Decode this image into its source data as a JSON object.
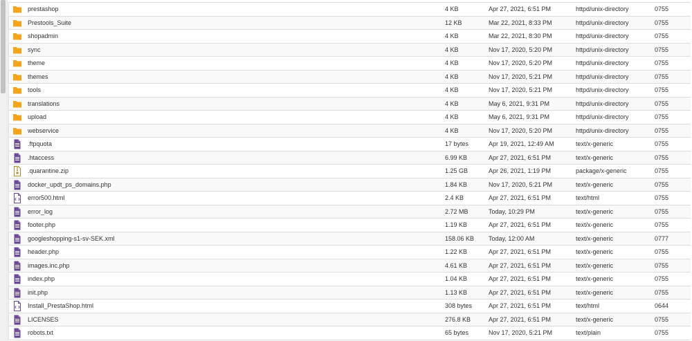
{
  "colors": {
    "folder": "#f3a51c",
    "file": "#6c4a95",
    "archive": "#b08a2e",
    "border": "#dcdcdc"
  },
  "files": [
    {
      "name": "prestashop",
      "size": "4 KB",
      "modified": "Apr 27, 2021, 6:51 PM",
      "type": "httpd/unix-directory",
      "perms": "0755",
      "icon": "folder-icon"
    },
    {
      "name": "Prestools_Suite",
      "size": "12 KB",
      "modified": "Mar 22, 2021, 8:33 PM",
      "type": "httpd/unix-directory",
      "perms": "0755",
      "icon": "folder-icon"
    },
    {
      "name": "shopadmin",
      "size": "4 KB",
      "modified": "Mar 22, 2021, 8:30 PM",
      "type": "httpd/unix-directory",
      "perms": "0755",
      "icon": "folder-icon"
    },
    {
      "name": "sync",
      "size": "4 KB",
      "modified": "Nov 17, 2020, 5:20 PM",
      "type": "httpd/unix-directory",
      "perms": "0755",
      "icon": "folder-icon"
    },
    {
      "name": "theme",
      "size": "4 KB",
      "modified": "Nov 17, 2020, 5:20 PM",
      "type": "httpd/unix-directory",
      "perms": "0755",
      "icon": "folder-icon"
    },
    {
      "name": "themes",
      "size": "4 KB",
      "modified": "Nov 17, 2020, 5:21 PM",
      "type": "httpd/unix-directory",
      "perms": "0755",
      "icon": "folder-icon"
    },
    {
      "name": "tools",
      "size": "4 KB",
      "modified": "Nov 17, 2020, 5:21 PM",
      "type": "httpd/unix-directory",
      "perms": "0755",
      "icon": "folder-icon"
    },
    {
      "name": "translations",
      "size": "4 KB",
      "modified": "May 6, 2021, 9:31 PM",
      "type": "httpd/unix-directory",
      "perms": "0755",
      "icon": "folder-icon"
    },
    {
      "name": "upload",
      "size": "4 KB",
      "modified": "May 6, 2021, 9:31 PM",
      "type": "httpd/unix-directory",
      "perms": "0755",
      "icon": "folder-icon"
    },
    {
      "name": "webservice",
      "size": "4 KB",
      "modified": "Nov 17, 2020, 5:20 PM",
      "type": "httpd/unix-directory",
      "perms": "0755",
      "icon": "folder-icon"
    },
    {
      "name": ".ftpquota",
      "size": "17 bytes",
      "modified": "Apr 19, 2021, 12:49 AM",
      "type": "text/x-generic",
      "perms": "0755",
      "icon": "text-file-icon"
    },
    {
      "name": ".htaccess",
      "size": "6.99 KB",
      "modified": "Apr 27, 2021, 6:51 PM",
      "type": "text/x-generic",
      "perms": "0755",
      "icon": "text-file-icon"
    },
    {
      "name": ".quarantine.zip",
      "size": "1.25 GB",
      "modified": "Apr 26, 2021, 1:19 PM",
      "type": "package/x-generic",
      "perms": "0755",
      "icon": "archive-file-icon"
    },
    {
      "name": "docker_updt_ps_domains.php",
      "size": "1.84 KB",
      "modified": "Nov 17, 2020, 5:21 PM",
      "type": "text/x-generic",
      "perms": "0755",
      "icon": "text-file-icon"
    },
    {
      "name": "error500.html",
      "size": "2.4 KB",
      "modified": "Apr 27, 2021, 6:51 PM",
      "type": "text/html",
      "perms": "0755",
      "icon": "html-file-icon"
    },
    {
      "name": "error_log",
      "size": "2.72 MB",
      "modified": "Today, 10:29 PM",
      "type": "text/x-generic",
      "perms": "0755",
      "icon": "text-file-icon"
    },
    {
      "name": "footer.php",
      "size": "1.19 KB",
      "modified": "Apr 27, 2021, 6:51 PM",
      "type": "text/x-generic",
      "perms": "0755",
      "icon": "text-file-icon"
    },
    {
      "name": "googleshopping-s1-sv-SEK.xml",
      "size": "158.06 KB",
      "modified": "Today, 12:00 AM",
      "type": "text/x-generic",
      "perms": "0777",
      "icon": "text-file-icon"
    },
    {
      "name": "header.php",
      "size": "1.22 KB",
      "modified": "Apr 27, 2021, 6:51 PM",
      "type": "text/x-generic",
      "perms": "0755",
      "icon": "text-file-icon"
    },
    {
      "name": "images.inc.php",
      "size": "4.61 KB",
      "modified": "Apr 27, 2021, 6:51 PM",
      "type": "text/x-generic",
      "perms": "0755",
      "icon": "text-file-icon"
    },
    {
      "name": "index.php",
      "size": "1.04 KB",
      "modified": "Apr 27, 2021, 6:51 PM",
      "type": "text/x-generic",
      "perms": "0755",
      "icon": "text-file-icon"
    },
    {
      "name": "init.php",
      "size": "1.13 KB",
      "modified": "Apr 27, 2021, 6:51 PM",
      "type": "text/x-generic",
      "perms": "0755",
      "icon": "text-file-icon"
    },
    {
      "name": "Install_PrestaShop.html",
      "size": "308 bytes",
      "modified": "Apr 27, 2021, 6:51 PM",
      "type": "text/html",
      "perms": "0644",
      "icon": "html-file-icon"
    },
    {
      "name": "LICENSES",
      "size": "276.8 KB",
      "modified": "Apr 27, 2021, 6:51 PM",
      "type": "text/x-generic",
      "perms": "0755",
      "icon": "text-file-icon"
    },
    {
      "name": "robots.txt",
      "size": "65 bytes",
      "modified": "Nov 17, 2020, 5:21 PM",
      "type": "text/plain",
      "perms": "0755",
      "icon": "text-file-icon"
    }
  ]
}
